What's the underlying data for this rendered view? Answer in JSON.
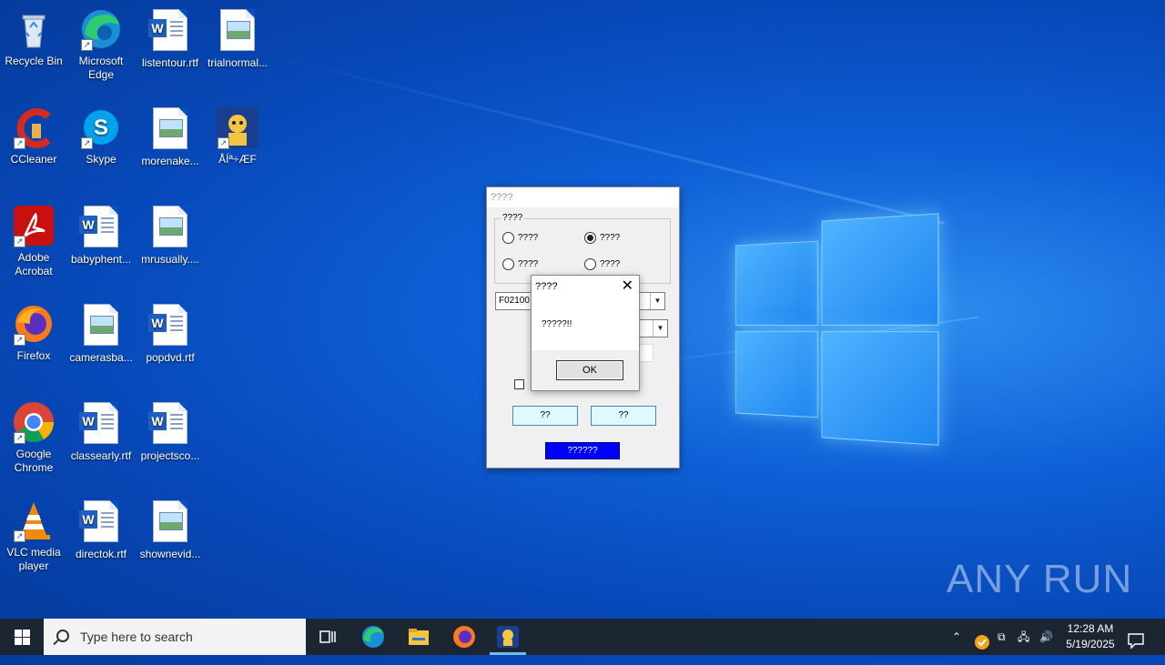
{
  "desktop": {
    "icons": [
      {
        "label": "Recycle Bin"
      },
      {
        "label": "Microsoft Edge"
      },
      {
        "label": "listentour.rtf"
      },
      {
        "label": "trialnormal..."
      },
      {
        "label": "CCleaner"
      },
      {
        "label": "Skype"
      },
      {
        "label": "morenake..."
      },
      {
        "label": "ÅÍª÷ÆF"
      },
      {
        "label": "Adobe Acrobat"
      },
      {
        "label": "babyphent..."
      },
      {
        "label": "mrusually...."
      },
      {
        "label": "Firefox"
      },
      {
        "label": "camerasba..."
      },
      {
        "label": "popdvd.rtf"
      },
      {
        "label": "Google Chrome"
      },
      {
        "label": "classearly.rtf"
      },
      {
        "label": "projectsco..."
      },
      {
        "label": "VLC media player"
      },
      {
        "label": "directok.rtf"
      },
      {
        "label": "shownevid..."
      }
    ]
  },
  "dialog": {
    "title": "????",
    "group_label": "????",
    "radios": [
      {
        "label": "????",
        "checked": false
      },
      {
        "label": "????",
        "checked": true
      },
      {
        "label": "????",
        "checked": false
      },
      {
        "label": "????",
        "checked": false
      }
    ],
    "combo1_value": "F02100",
    "button1": "??",
    "button2": "??",
    "status_text": "??????",
    "status_color": "#0000ff"
  },
  "msgbox": {
    "title": "????",
    "text": "?????!!",
    "ok_label": "OK"
  },
  "watermark": "ANY RUN",
  "taskbar": {
    "search_placeholder": "Type here to search",
    "time": "12:28 AM",
    "date": "5/19/2025"
  }
}
